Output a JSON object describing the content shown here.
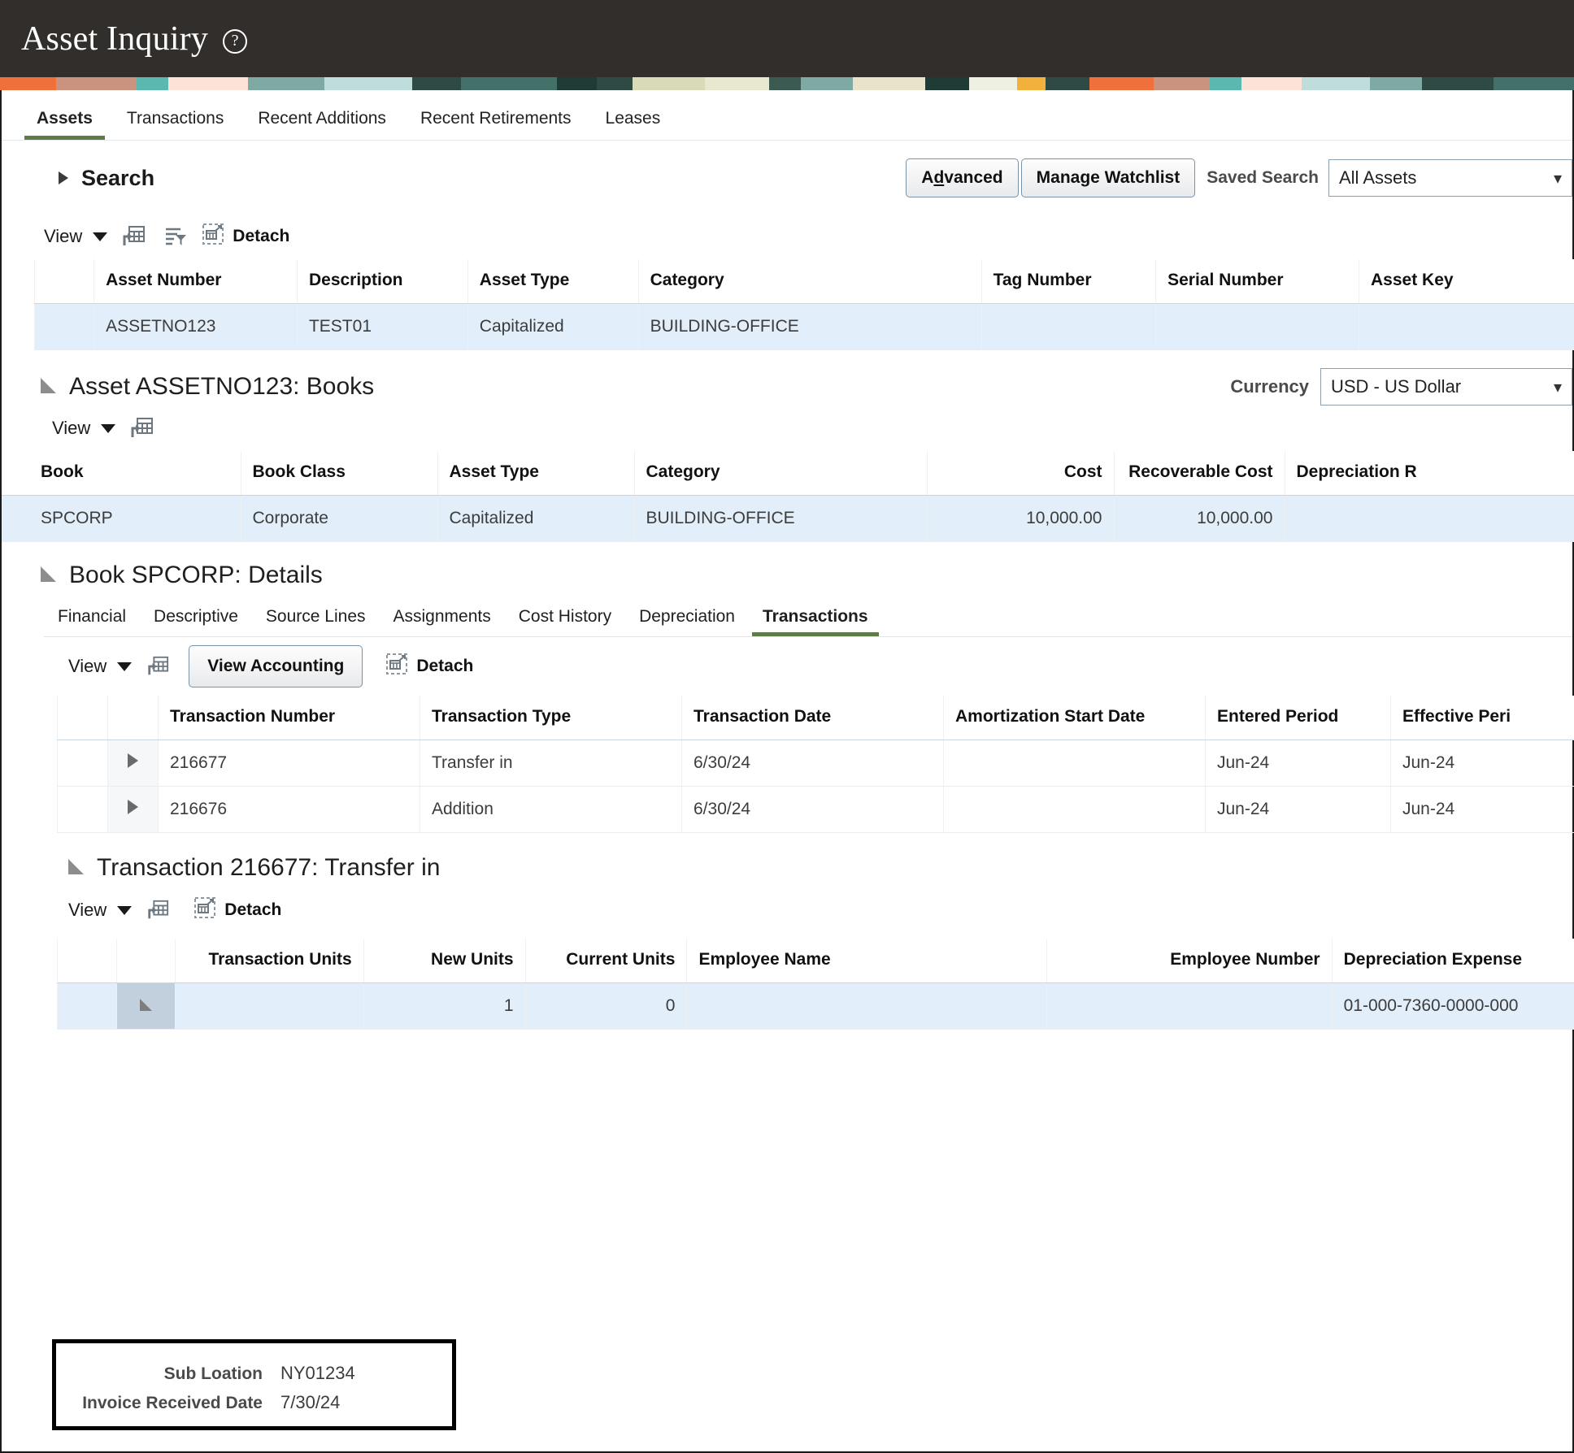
{
  "header": {
    "title": "Asset Inquiry",
    "help_icon": "question-circle-icon",
    "bg_color": "#322e2b",
    "deco_colors": [
      "#f0703c",
      "#c9937f",
      "#5ab8b0",
      "#fce3d8",
      "#7fa9a3",
      "#bfdedb",
      "#2f4a44",
      "#44706a",
      "#1f3b35",
      "#2f4a44",
      "#d9dbb8",
      "#e8e8d0",
      "#3a5a52",
      "#7fa9a3",
      "#e9e4c9",
      "#1f3b35",
      "#eef0e2",
      "#f2b13c",
      "#2f4a44",
      "#f0703c",
      "#c9937f",
      "#5ab8b0",
      "#fce3d8",
      "#bfdedb",
      "#7fa9a3",
      "#2f4a44",
      "#44706a"
    ]
  },
  "main_tabs": [
    {
      "label": "Assets",
      "active": true
    },
    {
      "label": "Transactions",
      "active": false
    },
    {
      "label": "Recent Additions",
      "active": false
    },
    {
      "label": "Recent Retirements",
      "active": false
    },
    {
      "label": "Leases",
      "active": false
    }
  ],
  "search": {
    "label": "Search",
    "disclosure_icon": "chevron-right-icon",
    "advanced_button": "Advanced",
    "advanced_accesskey": "d",
    "manage_watchlist_button": "Manage Watchlist",
    "saved_search_label": "Saved Search",
    "saved_search_value": "All Assets",
    "saved_search_options": [
      "All Assets"
    ]
  },
  "assets_toolbar": {
    "view_label": "View",
    "icons": [
      "export-to-excel-icon",
      "query-by-example-filter-icon",
      "detach-icon"
    ],
    "detach_label": "Detach"
  },
  "assets_table": {
    "columns": [
      "Asset Number",
      "Description",
      "Asset Type",
      "Category",
      "Tag Number",
      "Serial Number",
      "Asset Key"
    ],
    "rows": [
      {
        "selected": true,
        "cells": [
          "ASSETNO123",
          "TEST01",
          "Capitalized",
          "BUILDING-OFFICE",
          "",
          "",
          ""
        ]
      }
    ]
  },
  "books_section": {
    "title": "Asset ASSETNO123: Books",
    "disclosure_icon": "triangle-expanded-icon",
    "currency_label": "Currency",
    "currency_value": "USD - US Dollar",
    "currency_options": [
      "USD - US Dollar"
    ],
    "toolbar": {
      "view_label": "View",
      "icons": [
        "export-to-excel-icon"
      ]
    },
    "columns": [
      "Book",
      "Book Class",
      "Asset Type",
      "Category",
      "Cost",
      "Recoverable Cost",
      "Depreciation R"
    ],
    "rows": [
      {
        "selected": true,
        "cells": [
          "SPCORP",
          "Corporate",
          "Capitalized",
          "BUILDING-OFFICE",
          "10,000.00",
          "10,000.00",
          ""
        ]
      }
    ]
  },
  "details_section": {
    "title": "Book SPCORP: Details",
    "disclosure_icon": "triangle-expanded-icon",
    "tabs": [
      {
        "label": "Financial",
        "active": false
      },
      {
        "label": "Descriptive",
        "active": false
      },
      {
        "label": "Source Lines",
        "active": false
      },
      {
        "label": "Assignments",
        "active": false
      },
      {
        "label": "Cost History",
        "active": false
      },
      {
        "label": "Depreciation",
        "active": false
      },
      {
        "label": "Transactions",
        "active": true
      }
    ],
    "toolbar": {
      "view_label": "View",
      "icons": [
        "export-to-excel-icon",
        "detach-icon"
      ],
      "view_accounting_button": "View Accounting",
      "detach_label": "Detach"
    },
    "columns": [
      "Transaction Number",
      "Transaction Type",
      "Transaction Date",
      "Amortization Start Date",
      "Entered Period",
      "Effective Peri"
    ],
    "rows": [
      {
        "expand_icon": "triangle-collapsed-icon",
        "cells": [
          "216677",
          "Transfer in",
          "6/30/24",
          "",
          "Jun-24",
          "Jun-24"
        ]
      },
      {
        "expand_icon": "triangle-collapsed-icon",
        "cells": [
          "216676",
          "Addition",
          "6/30/24",
          "",
          "Jun-24",
          "Jun-24"
        ]
      }
    ]
  },
  "transaction_section": {
    "title": "Transaction 216677: Transfer in",
    "disclosure_icon": "triangle-expanded-icon",
    "toolbar": {
      "view_label": "View",
      "icons": [
        "export-to-excel-icon",
        "detach-icon"
      ],
      "detach_label": "Detach"
    },
    "columns": [
      "Transaction Units",
      "New Units",
      "Current Units",
      "Employee Name",
      "Employee Number",
      "Depreciation Expense"
    ],
    "rows": [
      {
        "selected": true,
        "expand_icon": "triangle-expanded-icon",
        "cells": [
          "",
          "1",
          "0",
          "",
          "",
          "01-000-7360-0000-000"
        ]
      }
    ]
  },
  "callout": {
    "rows": [
      {
        "label": "Sub Loation",
        "value": "NY01234"
      },
      {
        "label": "Invoice Received Date",
        "value": "7/30/24"
      }
    ]
  }
}
